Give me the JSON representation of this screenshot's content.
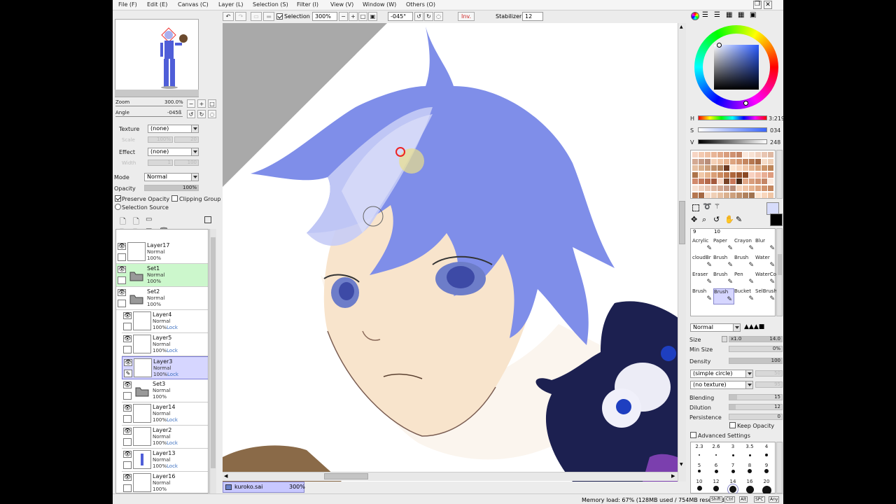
{
  "menu": [
    "File (F)",
    "Edit (E)",
    "Canvas (C)",
    "Layer (L)",
    "Selection (S)",
    "Filter (I)",
    "View (V)",
    "Window (W)",
    "Others (O)"
  ],
  "toolbar": {
    "selection_label": "Selection",
    "zoom_value": "300%",
    "angle_value": "-045°",
    "inv_label": "Inv.",
    "stabilizer_label": "Stabilizer",
    "stabilizer_value": "12"
  },
  "navigator": {
    "zoom_label": "Zoom",
    "zoom_value": "300.0%",
    "angle_label": "Angle",
    "angle_value": "-045ß"
  },
  "layer_props": {
    "texture_label": "Texture",
    "texture_value": "(none)",
    "scale_label": "Scale",
    "scale_value": "100%",
    "scale_num": "20",
    "effect_label": "Effect",
    "effect_value": "(none)",
    "width_label": "Width",
    "width_value": "1",
    "width_num": "100",
    "mode_label": "Mode",
    "mode_value": "Normal",
    "opacity_label": "Opacity",
    "opacity_value": "100%",
    "preserve_opacity": "Preserve Opacity",
    "clipping_group": "Clipping Group",
    "selection_source": "Selection Source"
  },
  "layers": [
    {
      "name": "Layer17",
      "mode": "Normal",
      "opacity": "100%",
      "lock": "",
      "kind": "layer"
    },
    {
      "name": "Set1",
      "mode": "Normal",
      "opacity": "100%",
      "lock": "",
      "kind": "folder"
    },
    {
      "name": "Set2",
      "mode": "Normal",
      "opacity": "100%",
      "lock": "",
      "kind": "folder"
    },
    {
      "name": "Layer4",
      "mode": "Normal",
      "opacity": "100%",
      "lock": "Lock",
      "kind": "layer"
    },
    {
      "name": "Layer5",
      "mode": "Normal",
      "opacity": "100%",
      "lock": "Lock",
      "kind": "layer"
    },
    {
      "name": "Layer3",
      "mode": "Normal",
      "opacity": "100%",
      "lock": "Lock",
      "kind": "layer"
    },
    {
      "name": "Set3",
      "mode": "Normal",
      "opacity": "100%",
      "lock": "",
      "kind": "folder"
    },
    {
      "name": "Layer14",
      "mode": "Normal",
      "opacity": "100%",
      "lock": "Lock",
      "kind": "layer"
    },
    {
      "name": "Layer2",
      "mode": "Normal",
      "opacity": "100%",
      "lock": "Lock",
      "kind": "layer"
    },
    {
      "name": "Layer13",
      "mode": "Normal",
      "opacity": "100%",
      "lock": "Lock",
      "kind": "layer"
    },
    {
      "name": "Layer16",
      "mode": "Normal",
      "opacity": "100%",
      "lock": "",
      "kind": "layer"
    }
  ],
  "canvas": {
    "file_name": "kuroko.sai",
    "file_zoom": "300%"
  },
  "status": {
    "memory": "Memory load: 67% (128MB used / 754MB reserved)",
    "keys": [
      "Shift",
      "Ctrl",
      "Alt",
      "SPC",
      "Any"
    ]
  },
  "color": {
    "h_label": "H",
    "h_value": "219",
    "h_prefix": "3:",
    "s_label": "S",
    "s_value": "034",
    "v_label": "V",
    "v_value": "248"
  },
  "tools": [
    [
      "Acrylic",
      "Paper",
      "Crayon",
      "Blur"
    ],
    [
      "cloudBr",
      "Brush",
      "Brush",
      "Water"
    ],
    [
      "Eraser",
      "Brush",
      "Pen",
      "WaterCo"
    ],
    [
      "Brush",
      "Brush",
      "Bucket",
      "SelBrush"
    ]
  ],
  "tools_top_row": [
    "9",
    "10"
  ],
  "brush": {
    "mode": "Normal",
    "size_label": "Size",
    "size_mult": "x1.0",
    "size_value": "14.0",
    "min_size_label": "Min Size",
    "min_size_value": "0%",
    "density_label": "Density",
    "density_value": "100",
    "shape": "(simple circle)",
    "shape_num": "50",
    "texture": "(no texture)",
    "texture_num": "95",
    "blending_label": "Blending",
    "blending_value": "15",
    "dilution_label": "Dilution",
    "dilution_value": "12",
    "persistence_label": "Persistence",
    "persistence_value": "0",
    "keep_opacity": "Keep Opacity",
    "advanced": "Advanced Settings"
  },
  "size_presets": {
    "row1": [
      "2.3",
      "2.6",
      "3",
      "3.5",
      "4"
    ],
    "row2": [
      "5",
      "6",
      "7",
      "8",
      "9"
    ],
    "row3": [
      "10",
      "12",
      "14",
      "16",
      "20"
    ]
  },
  "accent": "#c8c8ff"
}
